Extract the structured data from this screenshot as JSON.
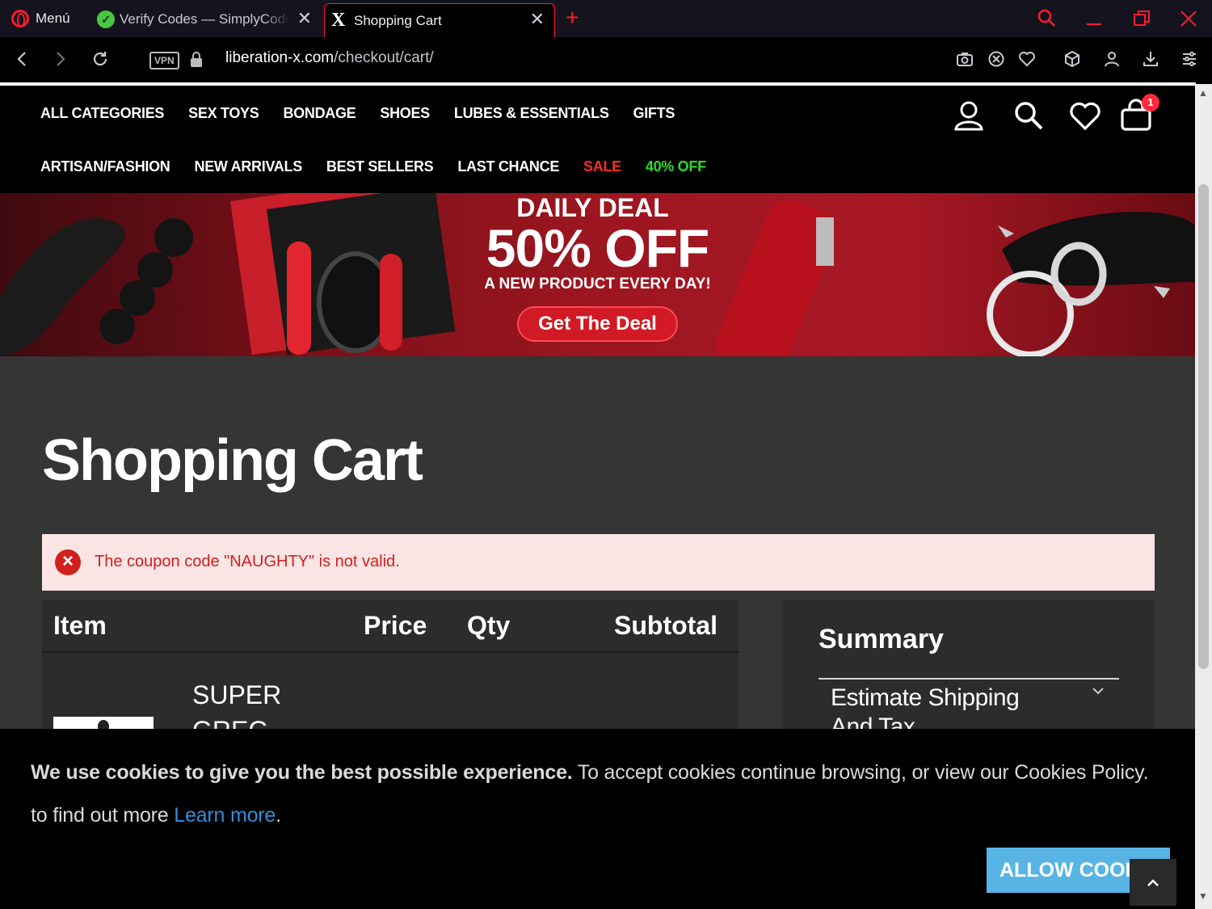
{
  "browser": {
    "menu_label": "Menú",
    "tabs": [
      {
        "title": "Verify Codes — SimplyCodes",
        "close": "✕"
      },
      {
        "title": "Shopping Cart",
        "close": "✕"
      }
    ],
    "new_tab": "+",
    "url_host": "liberation-x.com",
    "url_path": "/checkout/cart/",
    "vpn_label": "VPN",
    "accent_color": "#ff1b2d"
  },
  "nav": {
    "row1": [
      "ALL CATEGORIES",
      "SEX TOYS",
      "BONDAGE",
      "SHOES",
      "LUBES & ESSENTIALS",
      "GIFTS"
    ],
    "row2": [
      "ARTISAN/FASHION",
      "NEW ARRIVALS",
      "BEST SELLERS",
      "LAST CHANCE"
    ],
    "sale": "SALE",
    "forty_off": "40% OFF",
    "cart_count": "1"
  },
  "banner": {
    "line1": "DAILY DEAL",
    "line2": "50% OFF",
    "line3": "A NEW PRODUCT EVERY DAY!",
    "button": "Get The Deal"
  },
  "cart": {
    "title": "Shopping Cart",
    "error": "The coupon code \"NAUGHTY\" is not valid.",
    "headers": {
      "item": "Item",
      "price": "Price",
      "qty": "Qty",
      "subtotal": "Subtotal"
    },
    "product_name": "SUPER GREG"
  },
  "summary": {
    "title": "Summary",
    "shipping_toggle": "Estimate Shipping And Tax"
  },
  "cookie": {
    "bold": "We use cookies to give you the best possible experience.",
    "text": " To accept cookies continue browsing, or view our Cookies Policy. to find out more ",
    "link": "Learn more",
    "end": ".",
    "button": "ALLOW COOKIES"
  }
}
